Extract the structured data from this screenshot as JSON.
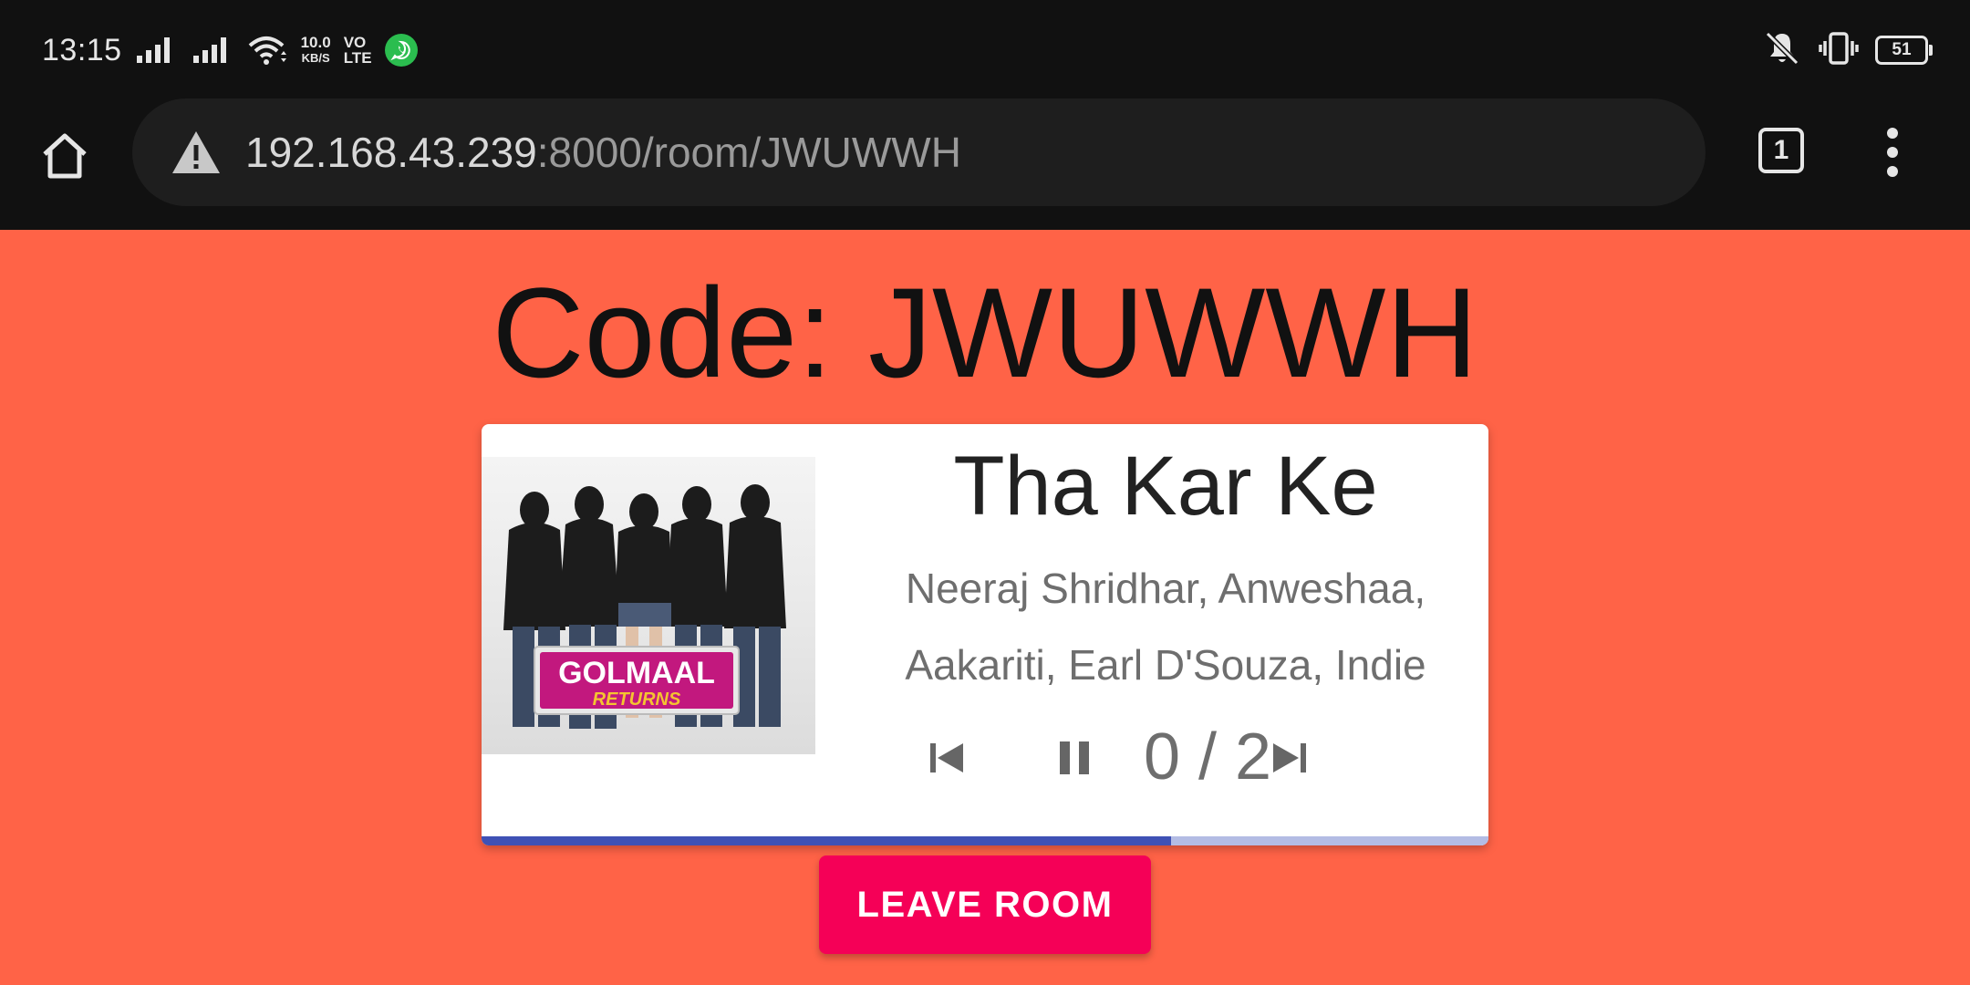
{
  "status_bar": {
    "time": "13:15",
    "net_speed_value": "10.0",
    "net_speed_unit": "KB/S",
    "volte_top": "VO",
    "volte_bottom": "LTE",
    "battery": "51",
    "icons": [
      "signal-icon",
      "signal-icon",
      "wifi-icon",
      "whatsapp-icon",
      "mute-icon",
      "vibrate-icon",
      "battery-icon"
    ]
  },
  "browser": {
    "url_host": "192.168.43.239",
    "url_rest": ":8000/room/JWUWWH",
    "tab_count": "1",
    "icons": [
      "home-icon",
      "warning-icon",
      "tabs-icon",
      "more-vert-icon"
    ]
  },
  "page": {
    "room_code": "Code: JWUWWH",
    "song": {
      "title": "Tha Kar Ke",
      "artist": "Neeraj Shridhar, Anweshaa, Aakariti, Earl D'Souza, Indie",
      "album_text_line1": "GOLMAAL",
      "album_text_line2": "RETURNS",
      "progress_fraction": 0.685
    },
    "controls": {
      "counter": "0 / 2",
      "icons": [
        "skip-previous-icon",
        "pause-icon",
        "skip-next-icon"
      ]
    },
    "leave_button": "LEAVE ROOM",
    "colors": {
      "page_background": "#ff6347",
      "progress_fill": "#3f51b5",
      "progress_track": "#b3bce4",
      "leave_button": "#f50057"
    }
  }
}
